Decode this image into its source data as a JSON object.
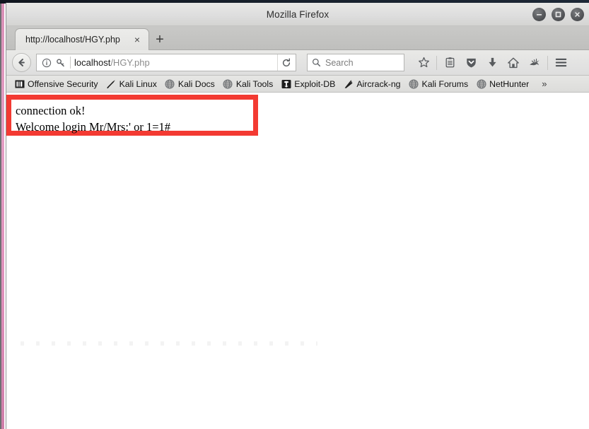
{
  "window": {
    "title": "Mozilla Firefox",
    "controls": [
      {
        "name": "minimize-button",
        "glyph": "minimize"
      },
      {
        "name": "maximize-button",
        "glyph": "maximize"
      },
      {
        "name": "close-button",
        "glyph": "close"
      }
    ]
  },
  "tabs": {
    "active": {
      "title": "http://localhost/HGY.php",
      "close_label": "×"
    },
    "new_tab_label": "+"
  },
  "navbar": {
    "back_icon": "back-arrow-icon",
    "identity_icon": "info-circle-icon",
    "permission_icon": "key-icon",
    "url": {
      "host": "localhost",
      "path": "/HGY.php",
      "full": "localhost/HGY.php"
    },
    "reload_icon": "reload-icon",
    "search": {
      "placeholder": "Search",
      "icon": "search-icon"
    },
    "icons": [
      {
        "name": "bookmark-star-icon",
        "label": "Bookmark this page"
      },
      {
        "name": "library-icon",
        "label": "Show your library"
      },
      {
        "name": "pocket-shield-icon",
        "label": "Save to Pocket"
      },
      {
        "name": "downloads-icon",
        "label": "Downloads"
      },
      {
        "name": "home-icon",
        "label": "Home"
      },
      {
        "name": "kali-dragon-icon",
        "label": "Kali"
      },
      {
        "name": "hamburger-menu-icon",
        "label": "Open menu"
      }
    ]
  },
  "bookmarks": {
    "items": [
      {
        "label": "Offensive Security",
        "icon": "offsec-icon"
      },
      {
        "label": "Kali Linux",
        "icon": "kali-dragon-icon"
      },
      {
        "label": "Kali Docs",
        "icon": "globe-icon"
      },
      {
        "label": "Kali Tools",
        "icon": "globe-icon"
      },
      {
        "label": "Exploit-DB",
        "icon": "exploitdb-icon"
      },
      {
        "label": "Aircrack-ng",
        "icon": "aircrack-icon"
      },
      {
        "label": "Kali Forums",
        "icon": "globe-icon"
      },
      {
        "label": "NetHunter",
        "icon": "globe-icon"
      }
    ],
    "overflow_label": "»"
  },
  "page": {
    "line1": "connection ok!",
    "line2": "Welcome login Mr/Mrs:' or 1=1#",
    "body": "connection ok!\nWelcome login Mr/Mrs:' or 1=1#",
    "highlight_color": "#f33a32"
  }
}
